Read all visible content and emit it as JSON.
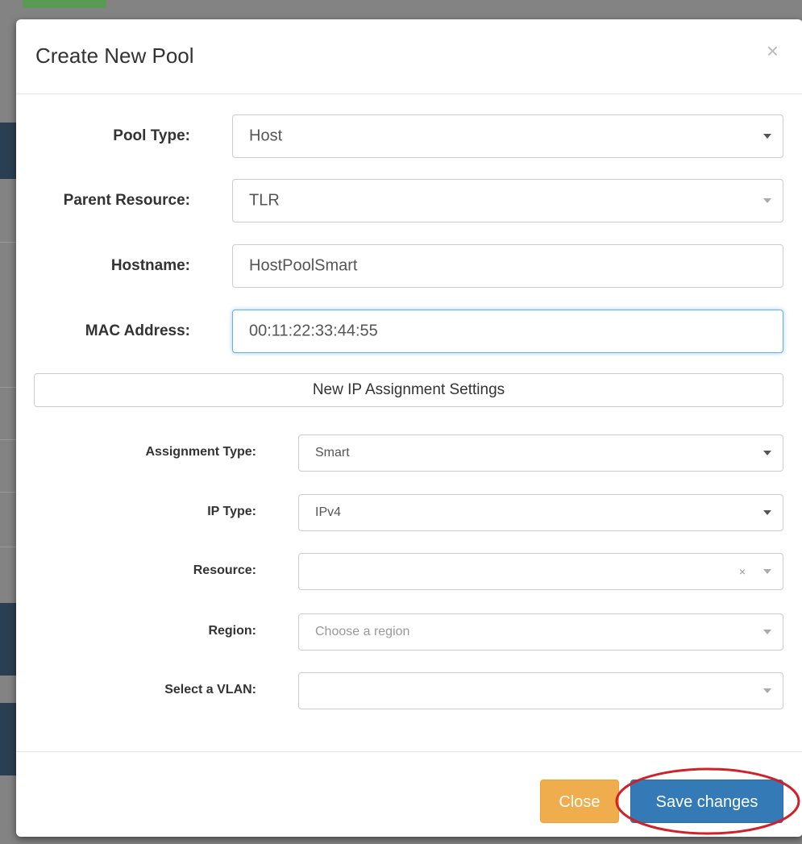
{
  "modal": {
    "title": "Create New Pool",
    "close_glyph": "×"
  },
  "form": {
    "pool_type": {
      "label": "Pool Type:",
      "value": "Host"
    },
    "parent_resource": {
      "label": "Parent Resource:",
      "value": "TLR"
    },
    "hostname": {
      "label": "Hostname:",
      "value": "HostPoolSmart"
    },
    "mac_address": {
      "label": "MAC Address:",
      "value": "00:11:22:33:44:55"
    }
  },
  "assignment": {
    "section_title": "New IP Assignment Settings",
    "assignment_type": {
      "label": "Assignment Type:",
      "value": "Smart"
    },
    "ip_type": {
      "label": "IP Type:",
      "value": "IPv4"
    },
    "resource": {
      "label": "Resource:",
      "value": "",
      "clear_glyph": "×"
    },
    "region": {
      "label": "Region:",
      "placeholder": "Choose a region"
    },
    "vlan": {
      "label": "Select a VLAN:",
      "value": ""
    }
  },
  "footer": {
    "close_label": "Close",
    "save_label": "Save changes"
  },
  "colors": {
    "primary": "#337ab7",
    "warning": "#f0ad4e",
    "annotation": "#d0202a"
  },
  "icons": [
    "close-icon",
    "caret-down-icon",
    "clear-icon"
  ]
}
